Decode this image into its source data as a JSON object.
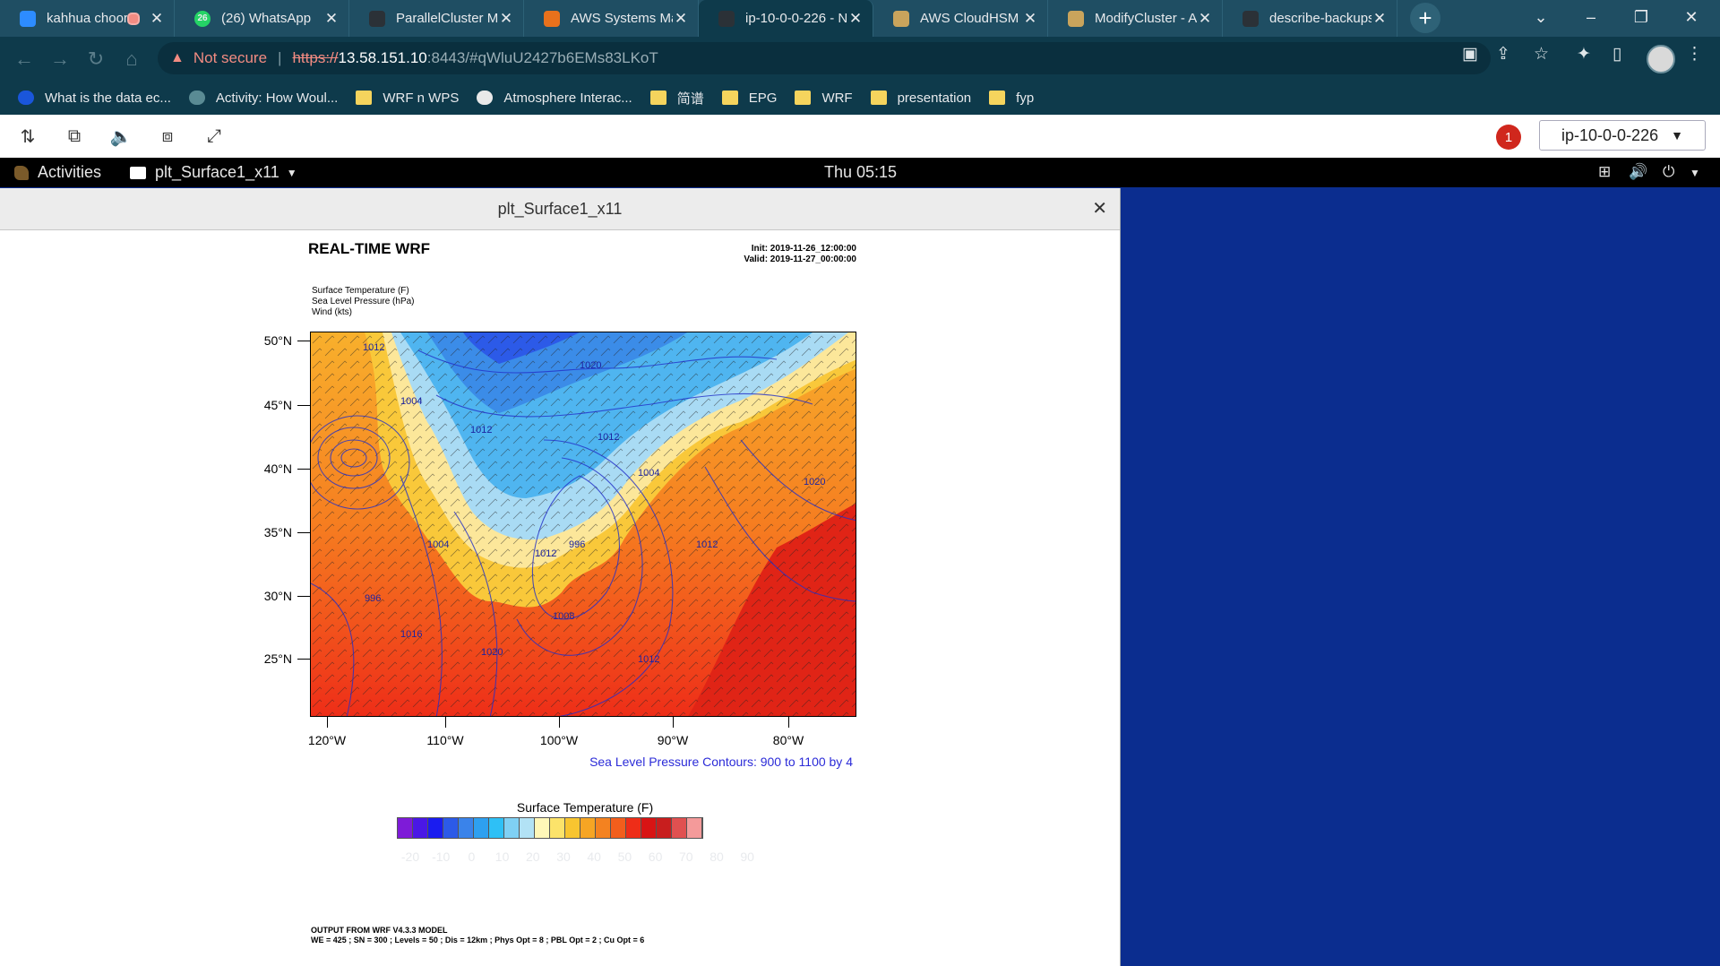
{
  "browser": {
    "tabs": [
      {
        "title": "kahhua choor",
        "icon": "zoom-icon",
        "fav_color": "#2d8cff",
        "recording": true
      },
      {
        "title": "(26) WhatsApp",
        "icon": "whatsapp-icon",
        "fav_color": "#25d366",
        "badge": "26"
      },
      {
        "title": "ParallelCluster M",
        "icon": "github-icon",
        "fav_color": "#2b3137"
      },
      {
        "title": "AWS Systems Ma",
        "icon": "aws-systems-manager-icon",
        "fav_color": "#e8711c"
      },
      {
        "title": "ip-10-0-0-226 - N",
        "icon": "github-icon",
        "fav_color": "#2b3137",
        "active": true
      },
      {
        "title": "AWS CloudHSM u",
        "icon": "aws-doc-icon",
        "fav_color": "#c9a45c"
      },
      {
        "title": "ModifyCluster - A",
        "icon": "aws-doc-icon",
        "fav_color": "#c9a45c"
      },
      {
        "title": "describe-backups",
        "icon": "github-icon",
        "fav_color": "#2b3137"
      }
    ],
    "security_label": "Not secure",
    "url_scheme": "https://",
    "url_host": "13.58.151.10",
    "url_rest": ":8443/#qWluU2427b6EMs83LKoT",
    "bookmarks": [
      {
        "label": "What is the data ec...",
        "icon": "c-icon"
      },
      {
        "label": "Activity: How Woul...",
        "icon": "globe-icon"
      },
      {
        "label": "WRF n WPS",
        "icon": "folder-icon"
      },
      {
        "label": "Atmosphere Interac...",
        "icon": "site-icon"
      },
      {
        "label": "简谱",
        "icon": "folder-icon"
      },
      {
        "label": "EPG",
        "icon": "folder-icon"
      },
      {
        "label": "WRF",
        "icon": "folder-icon"
      },
      {
        "label": "presentation",
        "icon": "folder-icon"
      },
      {
        "label": "fyp",
        "icon": "folder-icon"
      }
    ]
  },
  "dcv": {
    "notification_count": "1",
    "session_label": "ip-10-0-0-226"
  },
  "gnome": {
    "activities": "Activities",
    "app_name": "plt_Surface1_x11",
    "clock": "Thu 05:15"
  },
  "window": {
    "title": "plt_Surface1_x11"
  },
  "plot": {
    "title": "REAL-TIME WRF",
    "init": "Init: 2019-11-26_12:00:00",
    "valid": "Valid: 2019-11-27_00:00:00",
    "fields": [
      "Surface Temperature   (F)",
      "Sea Level Pressure   (hPa)",
      "Wind   (kts)"
    ],
    "contour_note": "Sea Level Pressure Contours: 900 to 1100 by 4",
    "colorbar_title": "Surface Temperature   (F)",
    "footer1": "OUTPUT FROM WRF V4.3.3 MODEL",
    "footer2": "WE = 425 ; SN = 300 ; Levels = 50 ; Dis = 12km ; Phys Opt = 8 ; PBL Opt = 2 ; Cu Opt = 6",
    "lat_labels": [
      "50°N",
      "45°N",
      "40°N",
      "35°N",
      "30°N",
      "25°N"
    ],
    "lon_labels": [
      "120°W",
      "110°W",
      "100°W",
      "90°W",
      "80°W"
    ],
    "pressure_labels": [
      "1012",
      "1020",
      "1004",
      "1012",
      "1012",
      "1004",
      "1020",
      "996",
      "1012",
      "1004",
      "996",
      "1012",
      "1008",
      "1012",
      "1016",
      "1020"
    ],
    "colorbar_ticks": [
      "-20",
      "-10",
      "0",
      "10",
      "20",
      "30",
      "40",
      "50",
      "60",
      "70",
      "80",
      "90"
    ],
    "colorbar_colors": [
      "#7e1bd8",
      "#4a17e6",
      "#1a1cf0",
      "#2c5ae8",
      "#3a83ea",
      "#2ea0f0",
      "#2ec0f6",
      "#7fd0f4",
      "#b2e2f5",
      "#fff7b8",
      "#fce36a",
      "#f8c530",
      "#f6a524",
      "#f48220",
      "#f25e1c",
      "#ee2d18",
      "#d81414",
      "#c81e1e",
      "#e05050",
      "#f49a9a"
    ]
  }
}
